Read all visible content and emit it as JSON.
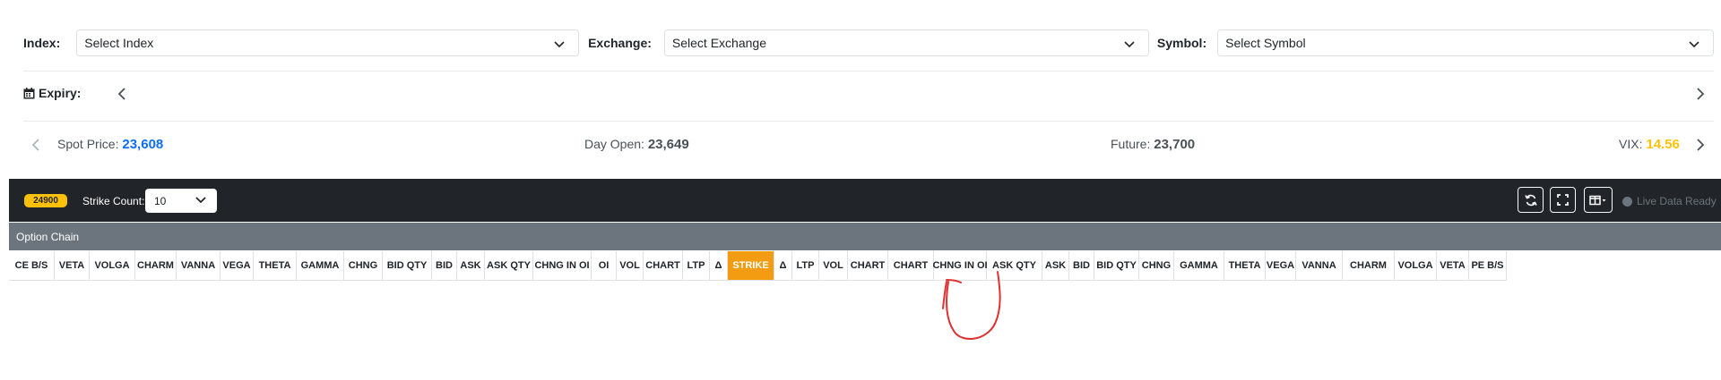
{
  "filters": {
    "index_label": "Index:",
    "index_value": "Select Index",
    "exchange_label": "Exchange:",
    "exchange_value": "Select Exchange",
    "symbol_label": "Symbol:",
    "symbol_value": "Select Symbol"
  },
  "expiry": {
    "label": "Expiry:"
  },
  "stats": {
    "spot_label": "Spot Price:",
    "spot_value": "23,608",
    "day_open_label": "Day Open:",
    "day_open_value": "23,649",
    "future_label": "Future:",
    "future_value": "23,700",
    "vix_label": "VIX:",
    "vix_value": "14.56"
  },
  "toolbar": {
    "badge": "24900",
    "strike_count_label": "Strike Count:",
    "strike_count_value": "10",
    "live_status": "Live Data Ready"
  },
  "section_title": "Option Chain",
  "columns": [
    "CE B/S",
    "VETA",
    "VOLGA",
    "CHARM",
    "VANNA",
    "VEGA",
    "THETA",
    "GAMMA",
    "CHNG",
    "BID QTY",
    "BID",
    "ASK",
    "ASK QTY",
    "CHNG IN OI",
    "OI",
    "VOL",
    "CHART",
    "LTP",
    "Δ",
    "STRIKE",
    "Δ",
    "LTP",
    "VOL",
    "CHART",
    "CHART",
    "CHNG IN OI",
    "ASK QTY",
    "ASK",
    "BID",
    "BID QTY",
    "CHNG",
    "GAMMA",
    "THETA",
    "VEGA",
    "VANNA",
    "CHARM",
    "VOLGA",
    "VETA",
    "PE B/S"
  ],
  "colors": {
    "dark_toolbar": "#212529",
    "section_bar": "#6c757d",
    "spot_value": "#0d6efd",
    "vix_value": "#ffc107",
    "strike_header": "#f39c12",
    "annotation": "#e03131"
  }
}
